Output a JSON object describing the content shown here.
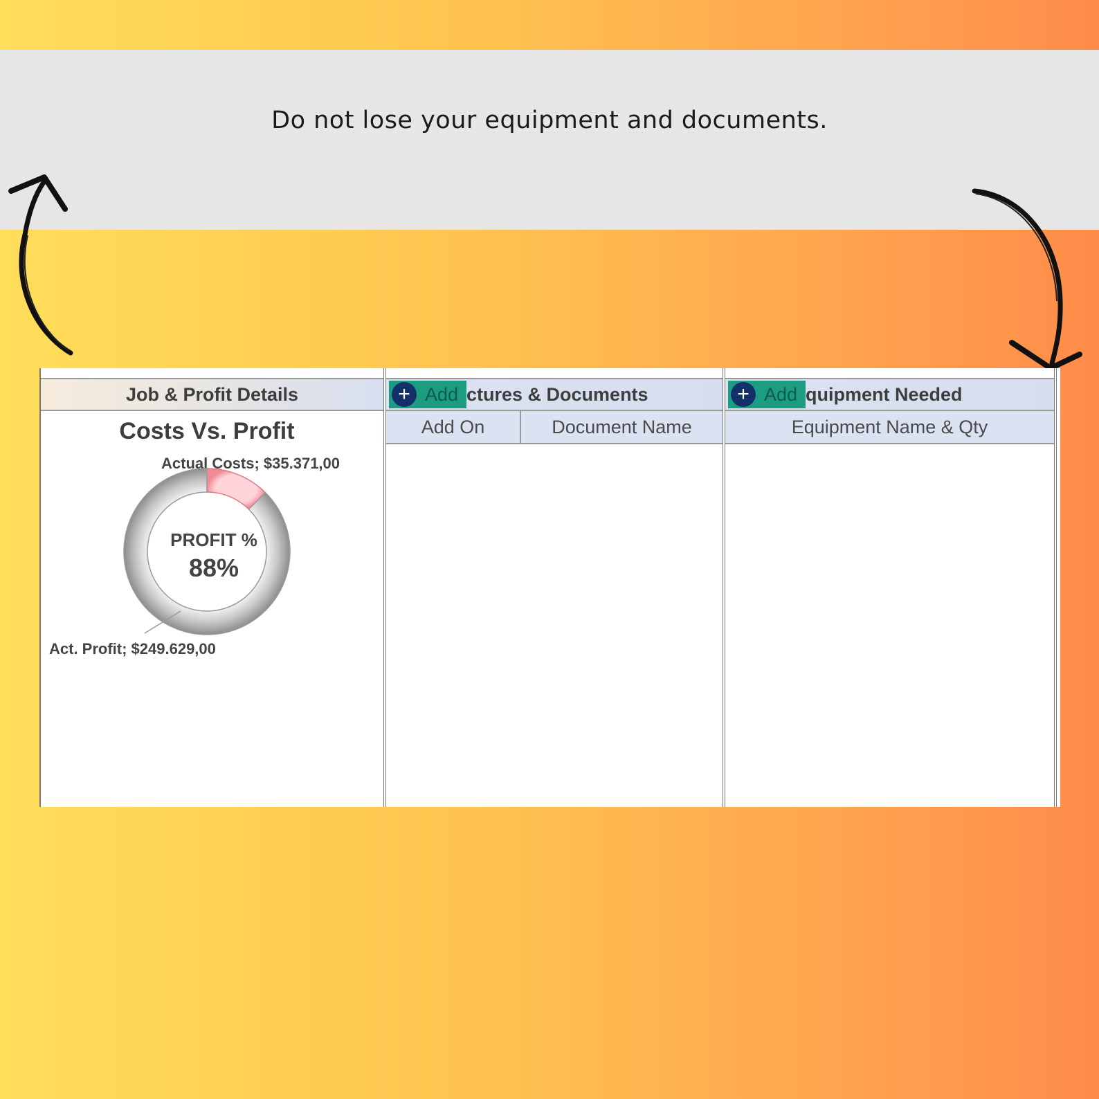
{
  "banner": {
    "text": "Do not lose your equipment and documents."
  },
  "panels": {
    "job_profit": {
      "header": "Job & Profit Details",
      "chart_title": "Costs Vs. Profit",
      "costs_label": "Actual Costs; $35.371,00",
      "profit_label": "Act. Profit; $249.629,00",
      "center_caption": "PROFIT %",
      "center_value": "88%"
    },
    "documents": {
      "add_label": "Add",
      "header": "ctures & Documents",
      "col1": "Add On",
      "col2": "Document Name"
    },
    "equipment": {
      "add_label": "Add",
      "header": "quipment Needed",
      "col1": "Equipment Name & Qty"
    }
  },
  "chart_data": {
    "type": "pie",
    "variant": "donut",
    "title": "Costs Vs. Profit",
    "slices": [
      {
        "name": "Actual Costs",
        "value": 35371.0,
        "color": "#f4a3ab"
      },
      {
        "name": "Act. Profit",
        "value": 249629.0,
        "color": "#bdbdbd"
      }
    ]
  },
  "colors": {
    "accent_button": "#1d9c82",
    "plus_icon": "#14306b"
  }
}
